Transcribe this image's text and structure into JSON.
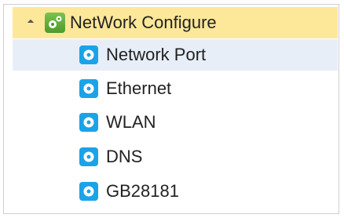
{
  "tree": {
    "root": {
      "label": "NetWork Configure",
      "expanded": true,
      "icon": "gears-icon"
    },
    "items": [
      {
        "label": "Network Port",
        "selected": true,
        "icon": "gear-icon"
      },
      {
        "label": "Ethernet",
        "selected": false,
        "icon": "gear-icon"
      },
      {
        "label": "WLAN",
        "selected": false,
        "icon": "gear-icon"
      },
      {
        "label": "DNS",
        "selected": false,
        "icon": "gear-icon"
      },
      {
        "label": "GB28181",
        "selected": false,
        "icon": "gear-icon"
      }
    ]
  },
  "colors": {
    "root_highlight": "#fde89a",
    "selected_row": "#e8eef8",
    "root_icon": "#5aa836",
    "item_icon": "#1aa3e8"
  }
}
